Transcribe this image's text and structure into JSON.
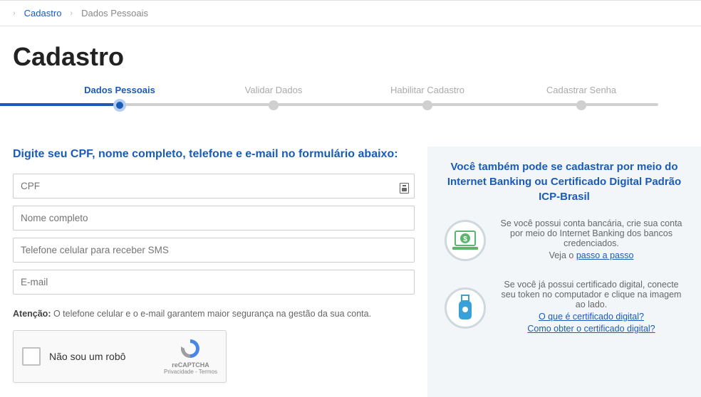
{
  "breadcrumb": {
    "link_label": "Cadastro",
    "current_label": "Dados Pessoais"
  },
  "page_title": "Cadastro",
  "steps": [
    {
      "label": "Dados Pessoais",
      "active": true
    },
    {
      "label": "Validar Dados",
      "active": false
    },
    {
      "label": "Habilitar Cadastro",
      "active": false
    },
    {
      "label": "Cadastrar Senha",
      "active": false
    }
  ],
  "form": {
    "heading": "Digite seu CPF, nome completo, telefone e e-mail no formulário abaixo:",
    "cpf_placeholder": "CPF",
    "name_placeholder": "Nome completo",
    "phone_placeholder": "Telefone celular para receber SMS",
    "email_placeholder": "E-mail",
    "attention_label": "Atenção:",
    "attention_text": " O telefone celular e o e-mail garantem maior segurança na gestão da sua conta."
  },
  "recaptcha": {
    "label": "Não sou um robô",
    "brand": "reCAPTCHA",
    "privacy": "Privacidade",
    "terms": "Termos"
  },
  "right": {
    "heading": "Você também pode se cadastrar por meio do Internet Banking ou Certificado Digital Padrão ICP-Brasil",
    "bank_text1": "Se você possui conta bancária, crie sua conta por meio do Internet Banking dos bancos credenciados.",
    "bank_text2_prefix": "Veja o ",
    "bank_link": "passo a passo",
    "cert_text1": "Se você já possui certificado digital, conecte seu token no computador e clique na imagem ao lado.",
    "cert_link1": "O que é certificado digital?",
    "cert_link2": "Como obter o certificado digital?"
  }
}
